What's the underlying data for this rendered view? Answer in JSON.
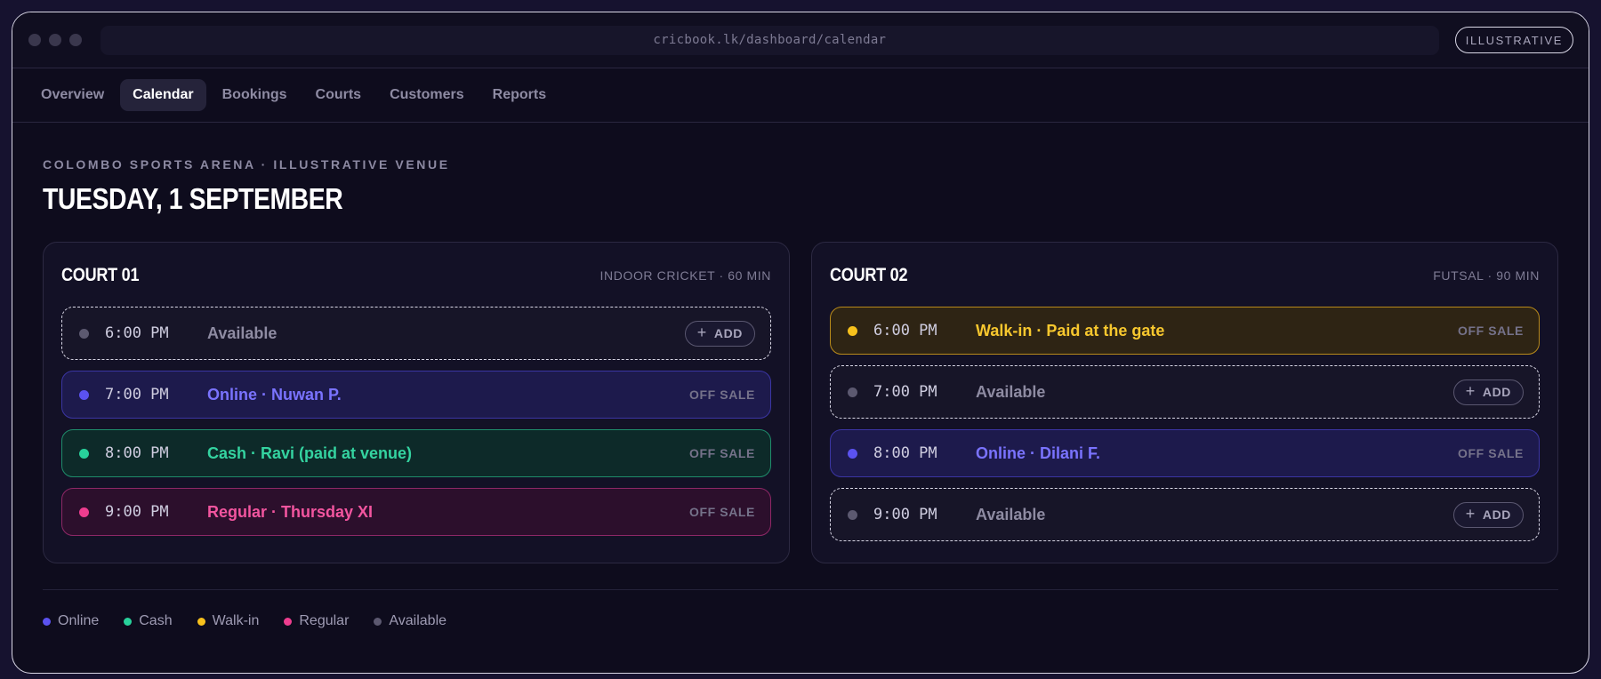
{
  "browser": {
    "url": "cricbook.lk/dashboard/calendar",
    "badge": "ILLUSTRATIVE"
  },
  "tabs": [
    {
      "label": "Overview",
      "active": false
    },
    {
      "label": "Calendar",
      "active": true
    },
    {
      "label": "Bookings",
      "active": false
    },
    {
      "label": "Courts",
      "active": false
    },
    {
      "label": "Customers",
      "active": false
    },
    {
      "label": "Reports",
      "active": false
    }
  ],
  "header": {
    "venue": "COLOMBO SPORTS ARENA · ILLUSTRATIVE VENUE",
    "date": "TUESDAY, 1 SEPTEMBER"
  },
  "courts": [
    {
      "name": "COURT 01",
      "meta": "INDOOR CRICKET · 60 MIN",
      "slots": [
        {
          "time": "6:00 PM",
          "label": "Available",
          "type": "available",
          "action": "ADD"
        },
        {
          "time": "7:00 PM",
          "label": "Online · Nuwan P.",
          "type": "online",
          "status": "OFF SALE"
        },
        {
          "time": "8:00 PM",
          "label": "Cash · Ravi (paid at venue)",
          "type": "cash",
          "status": "OFF SALE"
        },
        {
          "time": "9:00 PM",
          "label": "Regular · Thursday XI",
          "type": "regular",
          "status": "OFF SALE"
        }
      ]
    },
    {
      "name": "COURT 02",
      "meta": "FUTSAL · 90 MIN",
      "slots": [
        {
          "time": "6:00 PM",
          "label": "Walk-in · Paid at the gate",
          "type": "walkin",
          "status": "OFF SALE"
        },
        {
          "time": "7:00 PM",
          "label": "Available",
          "type": "available",
          "action": "ADD"
        },
        {
          "time": "8:00 PM",
          "label": "Online · Dilani F.",
          "type": "online",
          "status": "OFF SALE"
        },
        {
          "time": "9:00 PM",
          "label": "Available",
          "type": "available",
          "action": "ADD"
        }
      ]
    }
  ],
  "legend": [
    {
      "label": "Online",
      "color": "#5b52f0"
    },
    {
      "label": "Cash",
      "color": "#28d19b"
    },
    {
      "label": "Walk-in",
      "color": "#f7c11c"
    },
    {
      "label": "Regular",
      "color": "#ee3d8f"
    },
    {
      "label": "Available",
      "color": "#5c5970"
    }
  ],
  "icons": {
    "add": "plus-icon",
    "window_controls": [
      "window-dot-icon",
      "window-dot-icon",
      "window-dot-icon"
    ]
  }
}
